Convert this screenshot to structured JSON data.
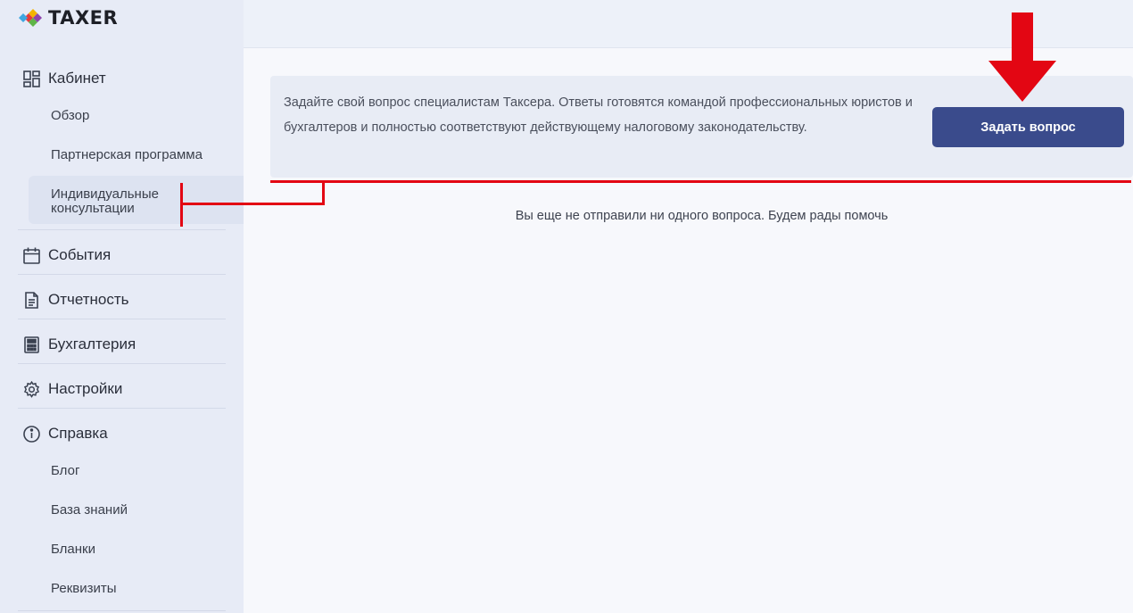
{
  "brand": {
    "name": "TAXER"
  },
  "sidebar": {
    "cabinet": {
      "label": "Кабинет",
      "icon": "dashboard-icon"
    },
    "cabinet_items": [
      "Обзор",
      "Партнерская программа"
    ],
    "active_item": {
      "label": "Индивидуальные консультации"
    },
    "sections": [
      {
        "label": "События",
        "icon": "calendar-icon"
      },
      {
        "label": "Отчетность",
        "icon": "document-icon"
      },
      {
        "label": "Бухгалтерия",
        "icon": "calculator-icon"
      },
      {
        "label": "Настройки",
        "icon": "gear-icon"
      },
      {
        "label": "Справка",
        "icon": "info-icon"
      }
    ],
    "help_items": [
      "Блог",
      "База знаний",
      "Бланки",
      "Реквизиты"
    ]
  },
  "main": {
    "info_text": "Задайте свой вопрос специалистам Таксера. Ответы готовятся командой профессиональных юристов и бухгалтеров и полностью соответствуют действующему налоговому законодательству.",
    "ask_button": "Задать вопрос",
    "empty_state": "Вы еще не отправили ни одного вопроса. Будем рады помочь"
  },
  "colors": {
    "sidebar_bg": "#e7ebf6",
    "button_bg": "#3a4b8c",
    "annotation_red": "#e30613"
  }
}
